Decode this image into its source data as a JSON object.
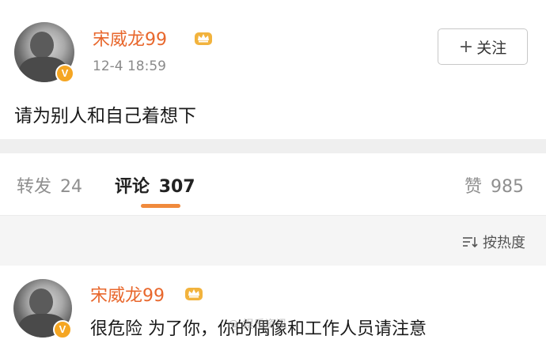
{
  "post": {
    "username": "宋威龙99",
    "timestamp": "12-4 18:59",
    "follow_label": "关注",
    "text": "请为别人和自己着想下",
    "verified_badge": "V"
  },
  "tabs": {
    "repost_label": "转发",
    "repost_count": "24",
    "comment_label": "评论",
    "comment_count": "307",
    "like_label": "赞",
    "like_count": "985"
  },
  "sort": {
    "label": "按热度"
  },
  "comment": {
    "username": "宋威龙99",
    "text": "很危险 为了你，你的偶像和工作人员请注意",
    "verified_badge": "V"
  },
  "watermark": "@ 娱乐资讯",
  "colors": {
    "username": "#e8672c",
    "badge": "#f5a623",
    "underline": "#f08a3c"
  }
}
